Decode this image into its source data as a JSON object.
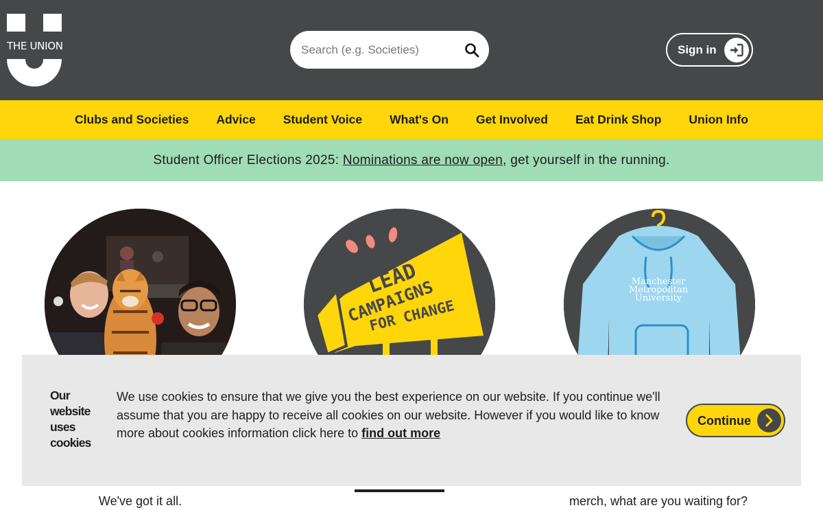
{
  "header": {
    "logo_text": "THE UNION",
    "search": {
      "placeholder": "Search (e.g. Societies)",
      "icon": "search-icon"
    },
    "signin": {
      "label": "Sign in",
      "icon": "sign-in-icon"
    }
  },
  "nav": {
    "items": [
      {
        "label": "Clubs and Societies"
      },
      {
        "label": "Advice"
      },
      {
        "label": "Student Voice"
      },
      {
        "label": "What's On"
      },
      {
        "label": "Get Involved"
      },
      {
        "label": "Eat Drink Shop"
      },
      {
        "label": "Union Info"
      }
    ]
  },
  "announcement": {
    "prefix": "Student Officer Elections 2025: ",
    "link_text": "Nominations are now open",
    "suffix": ", get yourself in the running."
  },
  "features": {
    "f2_poster_lines": [
      "LEAD",
      "CAMPAIGNS",
      "FOR CHANGE"
    ],
    "f3_hoodie_text": [
      "Manchester",
      "Metropolitan",
      "University"
    ],
    "f1_text_bottom": "We've got it all.",
    "f3_text_bottom": "merch, what are you waiting for?"
  },
  "cookie": {
    "title": "Our website uses cookies",
    "message": "We use cookies to ensure that we give you the best experience on our website. If you continue we'll assume that you are happy to receive all cookies on our website. However if you would like to know more about cookies information click here to ",
    "link_text": "find out more",
    "continue_label": "Continue",
    "continue_icon": "chevron-right-icon"
  },
  "colors": {
    "header_bg": "#454749",
    "nav_bg": "#ffd60a",
    "announce_bg": "#a0dcb5",
    "cookie_bg": "#e8e8e8"
  }
}
